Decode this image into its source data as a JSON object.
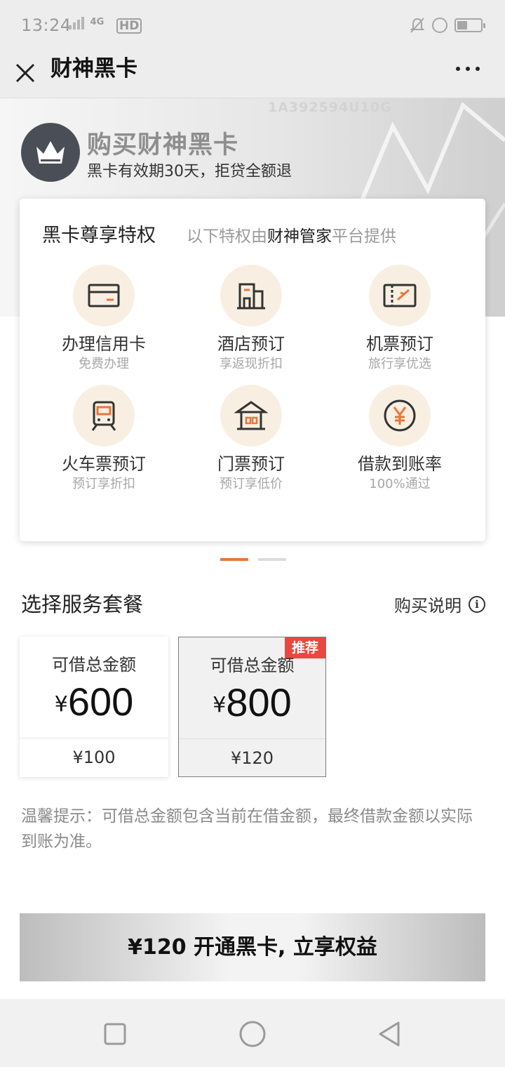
{
  "status_bar": {
    "time": "13:24",
    "network": "4G",
    "hd": "HD"
  },
  "navbar": {
    "title": "财神黑卡"
  },
  "hero": {
    "code": "1A392594U10G",
    "title": "购买财神黑卡",
    "subtitle": "黑卡有效期30天，拒贷全额退"
  },
  "privileges": {
    "heading": "黑卡尊享特权",
    "note_prefix": "以下特权由",
    "note_highlight": "财神管家",
    "note_suffix": "平台提供",
    "items": [
      {
        "name": "办理信用卡",
        "desc": "免费办理",
        "icon": "credit-card-icon"
      },
      {
        "name": "酒店预订",
        "desc": "享返现折扣",
        "icon": "hotel-icon"
      },
      {
        "name": "机票预订",
        "desc": "旅行享优选",
        "icon": "flight-ticket-icon"
      },
      {
        "name": "火车票预订",
        "desc": "预订享折扣",
        "icon": "train-icon"
      },
      {
        "name": "门票预订",
        "desc": "预订享低价",
        "icon": "pavilion-icon"
      },
      {
        "name": "借款到账率",
        "desc": "100%通过",
        "icon": "yen-icon"
      }
    ]
  },
  "pager": {
    "active_index": 0,
    "count": 2
  },
  "packages": {
    "title": "选择服务套餐",
    "help_label": "购买说明",
    "options": [
      {
        "label": "可借总金额",
        "currency": "¥",
        "amount": "600",
        "price": "¥100",
        "badge": "",
        "selected": false
      },
      {
        "label": "可借总金额",
        "currency": "¥",
        "amount": "800",
        "price": "¥120",
        "badge": "推荐",
        "selected": true
      }
    ]
  },
  "tip": "温馨提示：可借总金额包含当前在借金额，最终借款金额以实际到账为准。",
  "cta": {
    "label": "¥120 开通黑卡, 立享权益"
  },
  "colors": {
    "accent": "#e8763a",
    "badge": "#ec4640",
    "crown_bg": "#4a4f57",
    "icon_bg": "#f8efe2"
  }
}
